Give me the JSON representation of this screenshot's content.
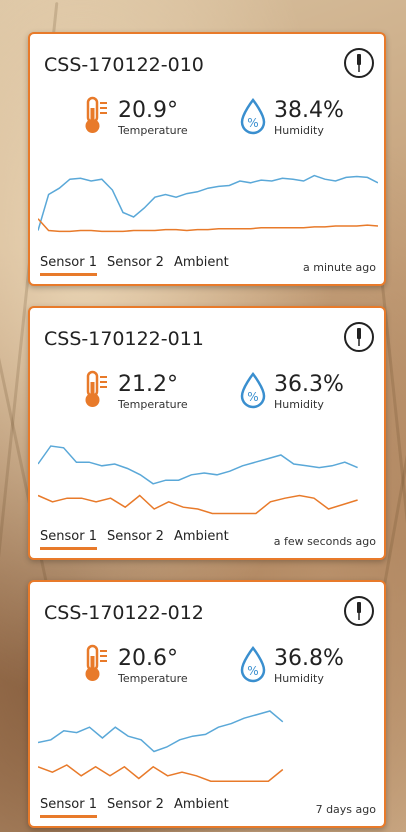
{
  "colors": {
    "accent": "#e87a2a",
    "humidity_line": "#5aa8d8",
    "temperature_line": "#e87a2a"
  },
  "icons": {
    "info": "thermometer-probe-icon",
    "temperature": "thermometer-icon",
    "humidity": "droplet-percent-icon"
  },
  "cards": [
    {
      "title": "CSS-170122-010",
      "temperature_value": "20.9°",
      "temperature_label": "Temperature",
      "humidity_value": "38.4%",
      "humidity_label": "Humidity",
      "tabs": [
        "Sensor 1",
        "Sensor 2",
        "Ambient"
      ],
      "active_tab": 0,
      "updated": "a minute ago",
      "humidity_series": [
        0.15,
        0.55,
        0.62,
        0.72,
        0.73,
        0.7,
        0.72,
        0.6,
        0.35,
        0.3,
        0.4,
        0.52,
        0.55,
        0.52,
        0.56,
        0.58,
        0.62,
        0.64,
        0.65,
        0.7,
        0.68,
        0.71,
        0.7,
        0.73,
        0.72,
        0.7,
        0.76,
        0.72,
        0.7,
        0.74,
        0.75,
        0.74,
        0.68
      ],
      "temperature_series": [
        0.28,
        0.15,
        0.14,
        0.14,
        0.15,
        0.15,
        0.14,
        0.14,
        0.14,
        0.15,
        0.15,
        0.15,
        0.16,
        0.16,
        0.15,
        0.16,
        0.16,
        0.17,
        0.17,
        0.17,
        0.17,
        0.18,
        0.18,
        0.18,
        0.18,
        0.18,
        0.19,
        0.19,
        0.2,
        0.2,
        0.2,
        0.21,
        0.2
      ]
    },
    {
      "title": "CSS-170122-011",
      "temperature_value": "21.2°",
      "temperature_label": "Temperature",
      "humidity_value": "36.3%",
      "humidity_label": "Humidity",
      "tabs": [
        "Sensor 1",
        "Sensor 2",
        "Ambient"
      ],
      "active_tab": 0,
      "updated": "a few seconds ago",
      "humidity_series": [
        0.6,
        0.8,
        0.78,
        0.62,
        0.62,
        0.58,
        0.6,
        0.55,
        0.48,
        0.38,
        0.42,
        0.42,
        0.48,
        0.5,
        0.48,
        0.52,
        0.58,
        0.62,
        0.66,
        0.7,
        0.6,
        0.58,
        0.56,
        0.58,
        0.62,
        0.56
      ],
      "temperature_series": [
        0.25,
        0.18,
        0.22,
        0.22,
        0.18,
        0.22,
        0.12,
        0.25,
        0.1,
        0.18,
        0.12,
        0.1,
        0.05,
        0.05,
        0.05,
        0.05,
        0.18,
        0.22,
        0.25,
        0.22,
        0.1,
        0.15,
        0.2
      ]
    },
    {
      "title": "CSS-170122-012",
      "temperature_value": "20.6°",
      "temperature_label": "Temperature",
      "humidity_value": "36.8%",
      "humidity_label": "Humidity",
      "tabs": [
        "Sensor 1",
        "Sensor 2",
        "Ambient"
      ],
      "active_tab": 0,
      "updated": "7 days ago",
      "humidity_series": [
        0.55,
        0.58,
        0.68,
        0.66,
        0.72,
        0.6,
        0.72,
        0.62,
        0.58,
        0.45,
        0.5,
        0.58,
        0.62,
        0.64,
        0.72,
        0.76,
        0.82,
        0.86,
        0.9,
        0.78
      ],
      "temperature_series": [
        0.28,
        0.22,
        0.3,
        0.18,
        0.28,
        0.18,
        0.28,
        0.15,
        0.28,
        0.18,
        0.22,
        0.18,
        0.12,
        0.12,
        0.12,
        0.12,
        0.12,
        0.25
      ]
    }
  ]
}
